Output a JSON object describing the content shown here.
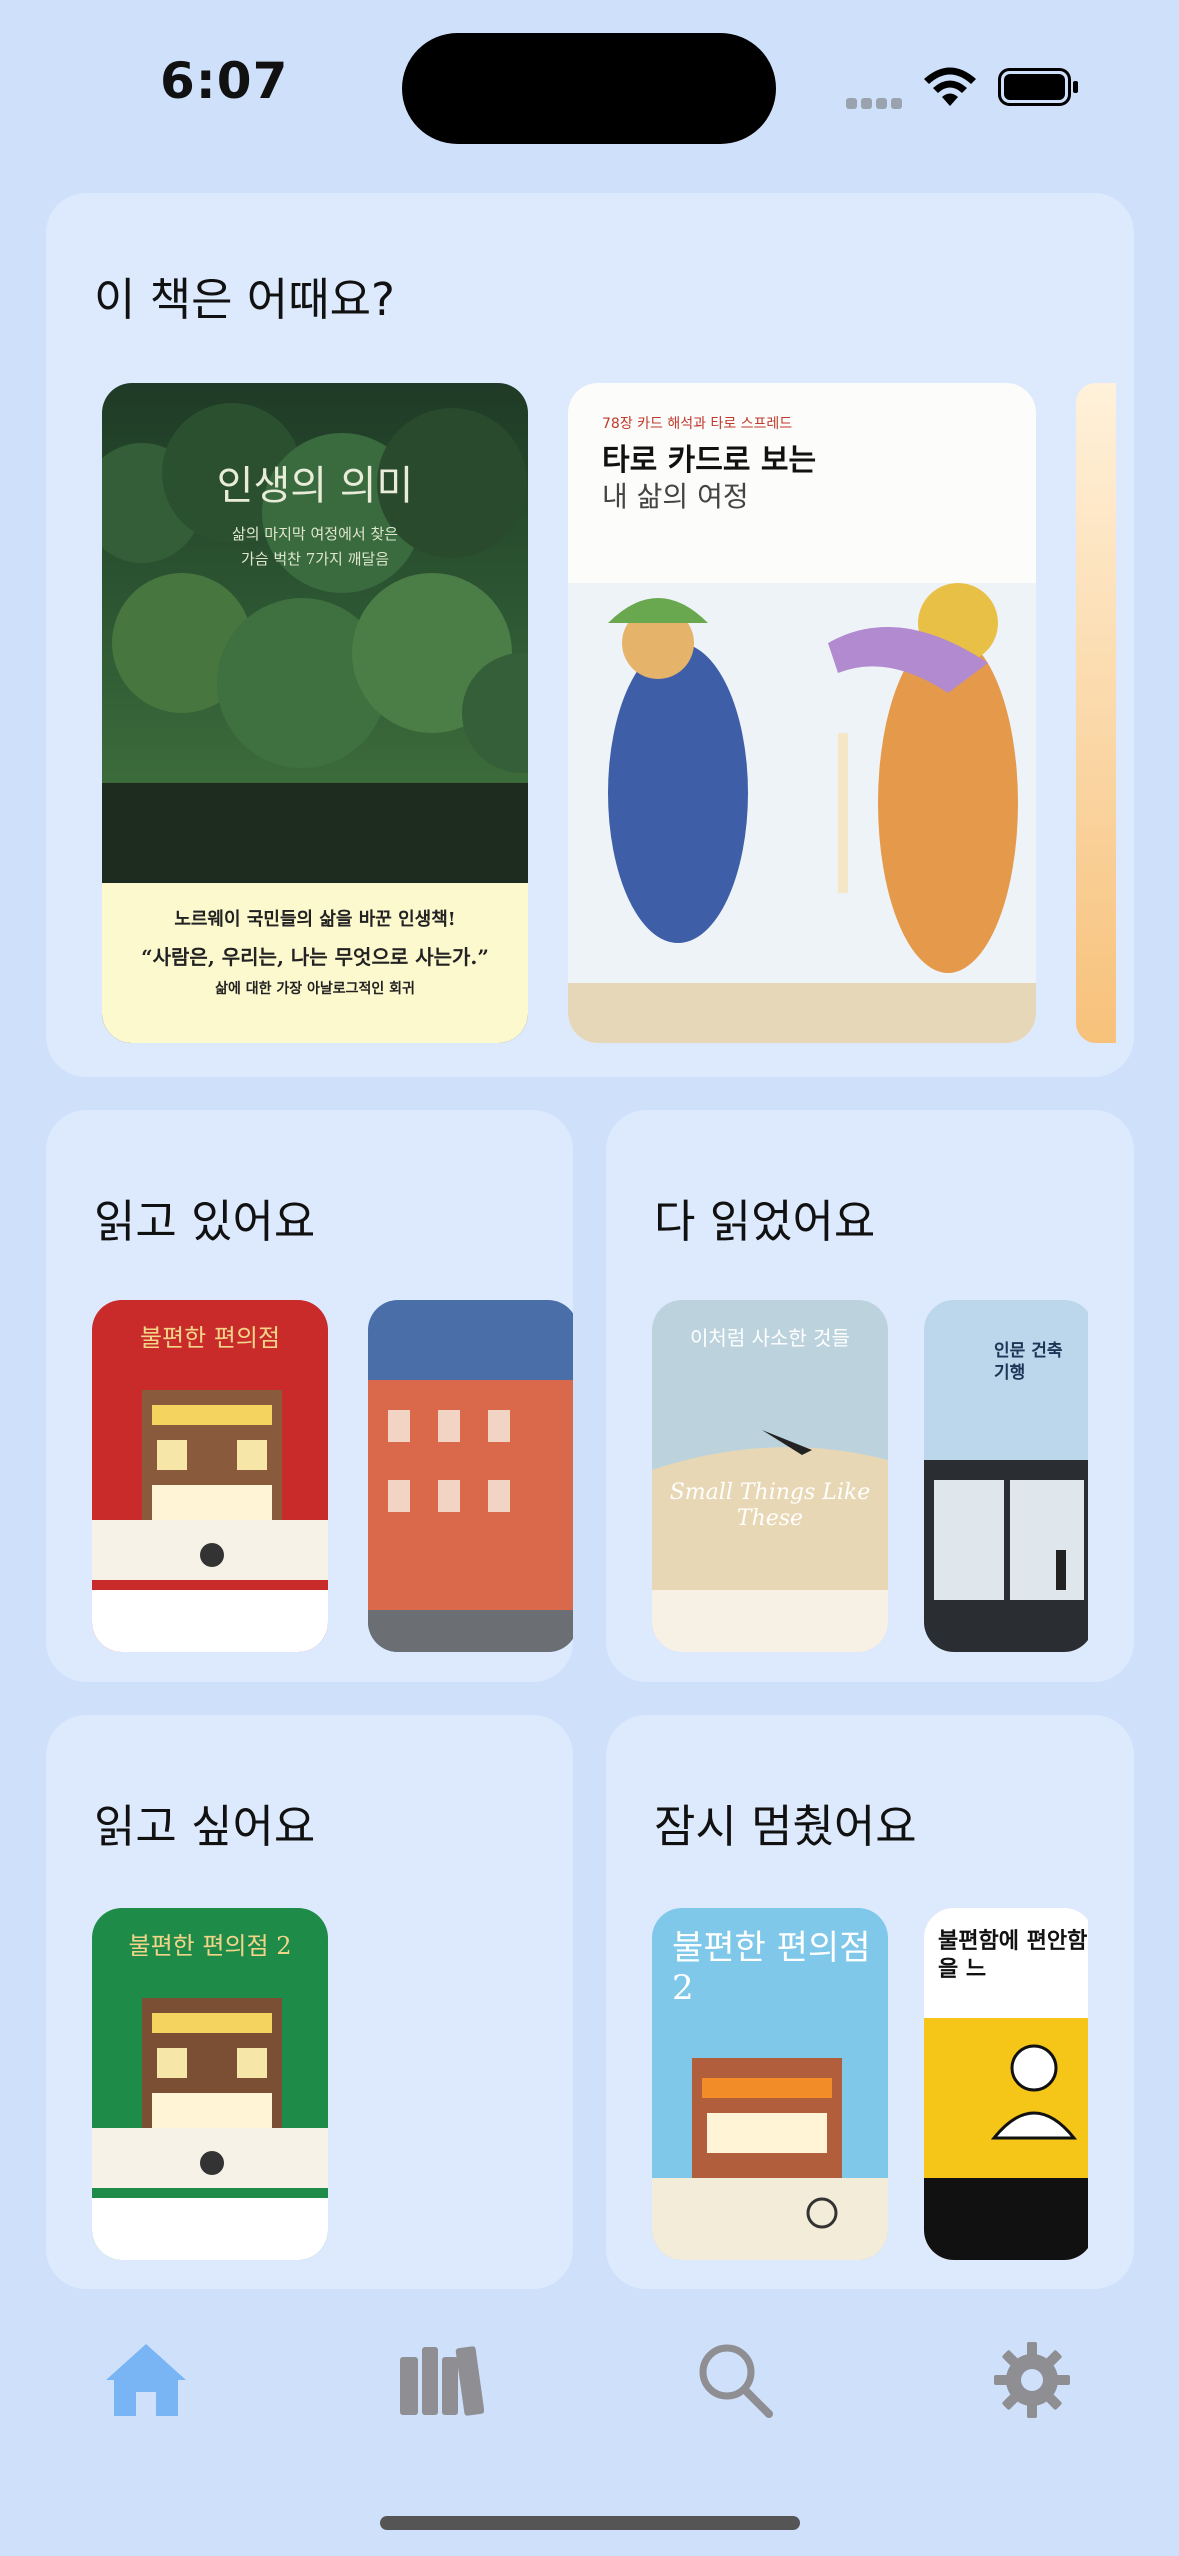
{
  "status": {
    "time": "6:07"
  },
  "colors": {
    "accent": "#79b4f5",
    "inactive_icon": "#8e8e93",
    "card_bg": "#dde9fd",
    "page_bg": "#cfe0fb"
  },
  "recommend": {
    "title": "이 책은 어때요?",
    "books": [
      {
        "title": "인생의 의미",
        "subtitle_lines": [
          "삶의 마지막 여정에서 찾은",
          "가슴 벅찬 7가지 깨달음"
        ],
        "band_lines": [
          "노르웨이 국민들의 삶을 바꾼 인생책!",
          "“사람은, 우리는, 나는 무엇으로 사는가.”",
          "삶에 대한 가장 아날로그적인 회귀"
        ]
      },
      {
        "kicker": "78장 카드 해석과 타로 스프레드",
        "title": "타로 카드로 보는",
        "title2": "내 삶의 여정"
      }
    ]
  },
  "reading": {
    "title": "읽고 있어요",
    "book1_title": "불편한 편의점"
  },
  "finished": {
    "title": "다 읽었어요",
    "book1_title_en": "Small Things Like These",
    "book1_title_ko": "이처럼 사소한 것들",
    "book2_title": "인문 건축 기행"
  },
  "want": {
    "title": "읽고 싶어요",
    "book1_title": "불편한 편의점 2"
  },
  "paused": {
    "title": "잠시 멈췄어요",
    "book1_title": "불편한 편의점2",
    "book2_title": "불편함에 편안함을 느"
  },
  "tabs": [
    {
      "name": "home",
      "icon": "house-icon",
      "active": true
    },
    {
      "name": "library",
      "icon": "books-icon",
      "active": false
    },
    {
      "name": "search",
      "icon": "magnifier-icon",
      "active": false
    },
    {
      "name": "settings",
      "icon": "gear-icon",
      "active": false
    }
  ]
}
